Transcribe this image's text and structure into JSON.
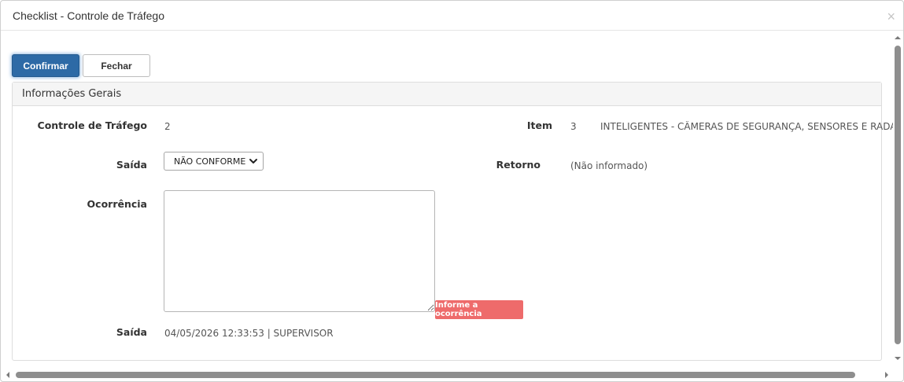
{
  "window": {
    "title": "Checklist - Controle de Tráfego",
    "close_glyph": "×"
  },
  "toolbar": {
    "confirm_label": "Confirmar",
    "close_label": "Fechar"
  },
  "panel": {
    "title": "Informações Gerais"
  },
  "fields": {
    "controle_label": "Controle de Tráfego",
    "controle_value": "2",
    "item_label": "Item",
    "item_number": "3",
    "item_description": "INTELIGENTES - CÂMERAS DE SEGURANÇA, SENSORES E RADARI",
    "saida_label": "Saída",
    "saida_selected": "NÃO CONFORME",
    "retorno_label": "Retorno",
    "retorno_value": "(Não informado)",
    "ocorrencia_label": "Ocorrência",
    "ocorrencia_value": "",
    "ocorrencia_error": "Informe a ocorrência",
    "saida_info_label": "Saída",
    "saida_info_value": "04/05/2026 12:33:53 | SUPERVISOR"
  },
  "colors": {
    "primary": "#2d6aa6",
    "error": "#ee6b6b",
    "scrollbar": "#8e8e8e"
  },
  "icons": {
    "close": "close-icon",
    "select_arrow": "chevron-down-icon",
    "scroll_up": "arrow-up-icon",
    "scroll_down": "arrow-down-icon",
    "scroll_left": "arrow-left-icon",
    "scroll_right": "arrow-right-icon"
  }
}
